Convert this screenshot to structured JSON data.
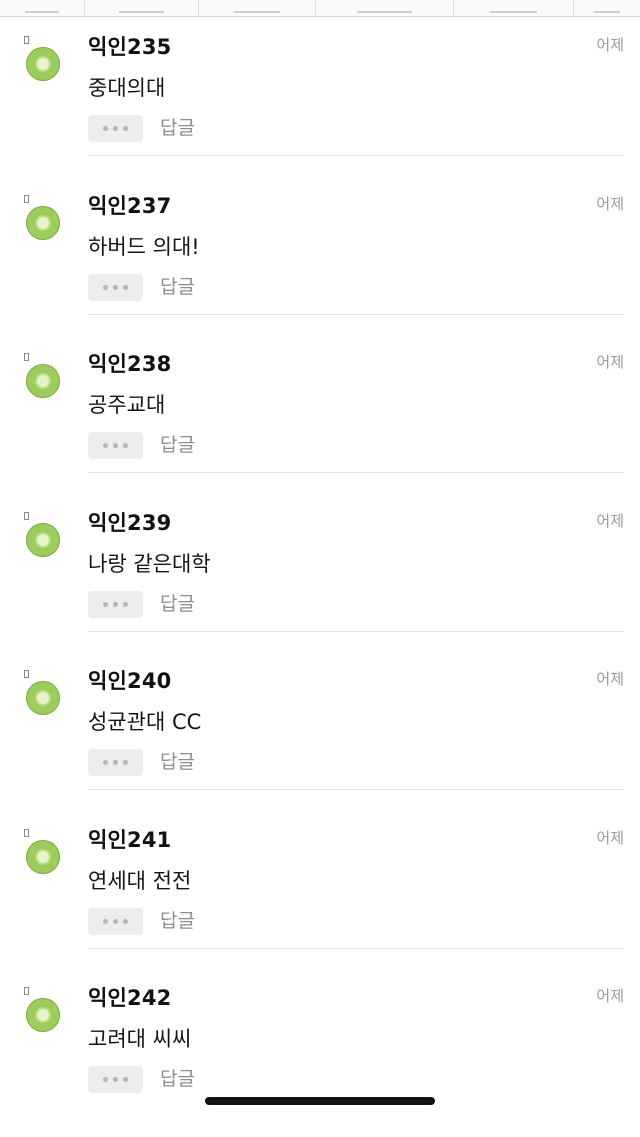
{
  "comments": [
    {
      "author": "익인235",
      "time": "어제",
      "text": "중대의대",
      "reply_label": "답글"
    },
    {
      "author": "익인237",
      "time": "어제",
      "text": "하버드 의대!",
      "reply_label": "답글"
    },
    {
      "author": "익인238",
      "time": "어제",
      "text": "공주교대",
      "reply_label": "답글"
    },
    {
      "author": "익인239",
      "time": "어제",
      "text": "나랑 같은대학",
      "reply_label": "답글"
    },
    {
      "author": "익인240",
      "time": "어제",
      "text": "성균관대 CC",
      "reply_label": "답글"
    },
    {
      "author": "익인241",
      "time": "어제",
      "text": "연세대 전전",
      "reply_label": "답글"
    },
    {
      "author": "익인242",
      "time": "어제",
      "text": "고려대 씨씨",
      "reply_label": "답글"
    }
  ],
  "icons": {
    "avatar": "green-circle-avatar-icon",
    "more": "ellipsis-icon",
    "pin": "pin-marker-icon"
  },
  "colors": {
    "avatar_green": "#9ccc5c",
    "meta_gray": "#9a9a9a",
    "button_bg": "#ededed"
  }
}
